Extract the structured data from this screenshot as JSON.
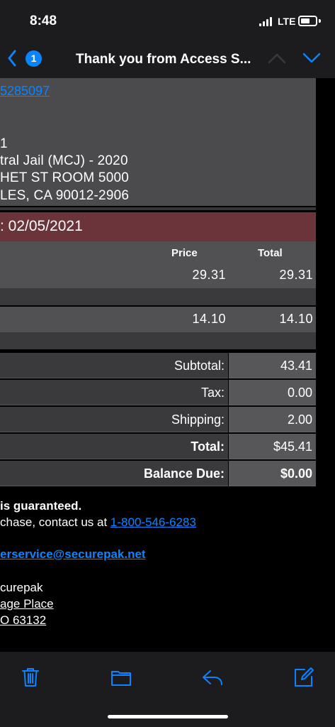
{
  "status_bar": {
    "time": "8:48",
    "network": "LTE"
  },
  "nav": {
    "unread_count": "1",
    "title": "Thank you from Access S..."
  },
  "email": {
    "order_link": "5285097",
    "address_lines": [
      "1",
      "tral Jail (MCJ) - 2020",
      "HET ST ROOM 5000",
      "LES, CA 90012-2906"
    ],
    "date_heading": ": 02/05/2021",
    "table_headers": {
      "price": "Price",
      "total": "Total"
    },
    "items": [
      {
        "price": "29.31",
        "total": "29.31"
      },
      {
        "price": "14.10",
        "total": "14.10"
      }
    ],
    "summary": [
      {
        "label": "Subtotal:",
        "value": "43.41",
        "bold": false
      },
      {
        "label": "Tax:",
        "value": "0.00",
        "bold": false
      },
      {
        "label": "Shipping:",
        "value": "2.00",
        "bold": false
      },
      {
        "label": "Total:",
        "value": "$45.41",
        "bold": true
      },
      {
        "label": "Balance Due:",
        "value": "$0.00",
        "bold": true
      }
    ],
    "footer": {
      "guarantee": "is guaranteed.",
      "contact_prefix": "chase, contact us at ",
      "phone": "1-800-546-6283",
      "email": "erservice@securepak.net",
      "company": "curepak",
      "street": "age Place",
      "city": "O 63132"
    }
  },
  "colors": {
    "accent": "#0a84ff",
    "date_bar": "#6b333a",
    "bar_bg": "#1c1c1e"
  },
  "icons": {
    "toolbar": [
      "trash-icon",
      "folder-icon",
      "reply-icon",
      "compose-icon"
    ]
  }
}
